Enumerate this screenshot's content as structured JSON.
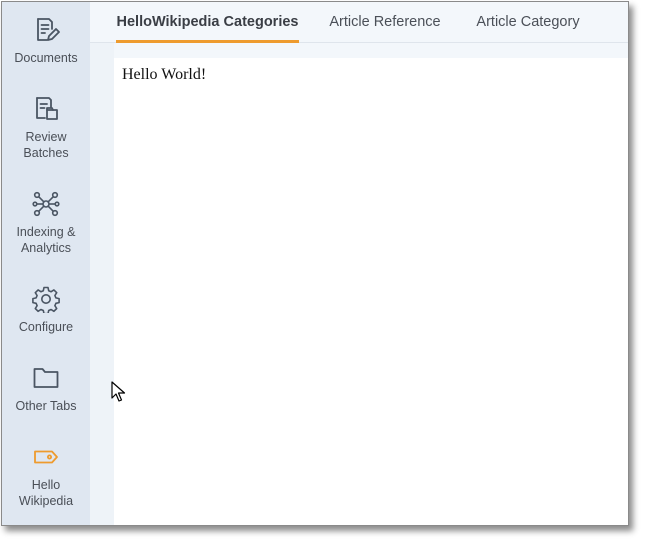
{
  "sidebar": {
    "items": [
      {
        "label": "Documents",
        "icon": "documents-icon"
      },
      {
        "label": "Review\nBatches",
        "icon": "review-batches-icon"
      },
      {
        "label": "Indexing &\nAnalytics",
        "icon": "network-icon"
      },
      {
        "label": "Configure",
        "icon": "gear-icon"
      },
      {
        "label": "Other Tabs",
        "icon": "folder-icon"
      },
      {
        "label": "Hello\nWikipedia",
        "icon": "tag-icon"
      }
    ],
    "active_index": 5,
    "accent_color": "#ee9b2e"
  },
  "tabs": [
    {
      "label": "HelloWikipedia Categories",
      "active": true
    },
    {
      "label": "Article Reference",
      "active": false
    },
    {
      "label": "Article Category",
      "active": false
    }
  ],
  "content": {
    "text": "Hello World!"
  }
}
